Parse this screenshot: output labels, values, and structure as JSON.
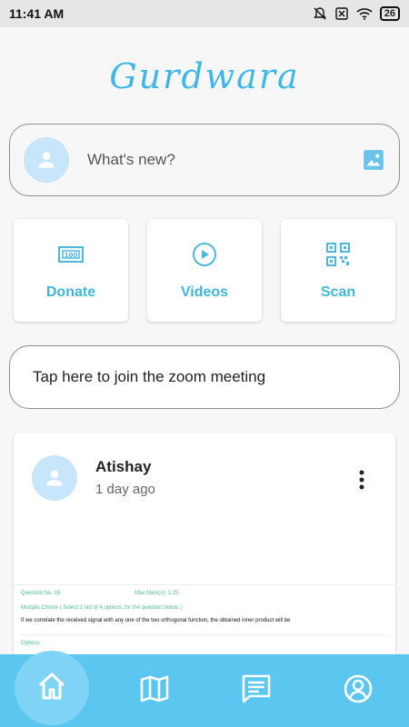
{
  "status_bar": {
    "time": "11:41 AM",
    "battery": "26",
    "icons": [
      "mute-bell-icon",
      "sim-off-icon",
      "wifi-icon",
      "battery-icon"
    ]
  },
  "app": {
    "title": "Gurdwara"
  },
  "composer": {
    "placeholder": "What's new?",
    "icons": [
      "avatar-icon",
      "image-icon"
    ]
  },
  "tiles": [
    {
      "label": "Donate",
      "icon": "cash-icon"
    },
    {
      "label": "Videos",
      "icon": "play-icon"
    },
    {
      "label": "Scan",
      "icon": "qr-code-icon"
    }
  ],
  "zoom_banner": {
    "text": "Tap here to join the zoom meeting"
  },
  "post": {
    "author": "Atishay",
    "time": "1 day ago",
    "image_text": {
      "question_no": "Question No. 03",
      "max_marks": "Max Mark(s): 1.25",
      "type": "Multiple Choice ( Select 1 out of 4 options, for the question below. )",
      "question": "If we correlate the received signal with any one of the two orthogonal function, the obtained inner product will be",
      "options_label": "Options"
    }
  },
  "bottom_nav": {
    "items": [
      "home-icon",
      "map-icon",
      "messages-icon",
      "profile-icon"
    ],
    "active": "home"
  },
  "colors": {
    "accent": "#3db7ea",
    "nav_background": "#5bc6ef",
    "nav_active": "#7fd3f4",
    "tile_text": "#3fb6dc",
    "avatar_bg": "#c8e6fb"
  }
}
